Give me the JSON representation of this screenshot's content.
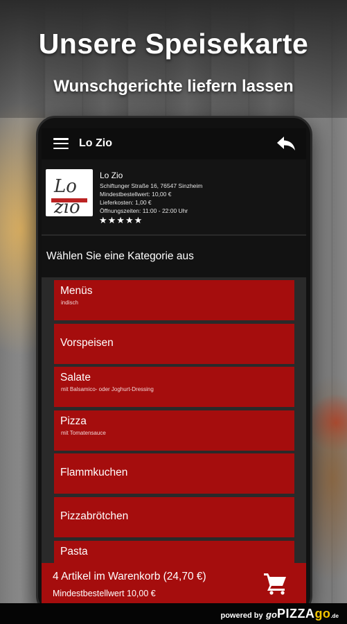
{
  "promo": {
    "headline": "Unsere Speisekarte",
    "subline": "Wunschgerichte liefern lassen"
  },
  "appbar": {
    "title": "Lo Zio",
    "menu_icon": "hamburger-menu-icon",
    "back_icon": "reply-back-arrow-icon"
  },
  "restaurant": {
    "name": "Lo Zio",
    "address": "Schiftunger Straße 16, 76547 Sinzheim",
    "min_order": "Mindestbestellwert: 10,00 €",
    "delivery_cost": "Lieferkosten: 1,00 €",
    "opening_hours": "Öffnungszeiten: 11:00 - 22:00 Uhr",
    "rating_stars": "★★★★★",
    "rating": 5,
    "logo_text": "Lo zio"
  },
  "category_prompt": "Wählen Sie eine Kategorie aus",
  "categories": [
    {
      "title": "Menüs",
      "subtitle": "indisch"
    },
    {
      "title": "Vorspeisen",
      "subtitle": ""
    },
    {
      "title": "Salate",
      "subtitle": "mit Balsamico- oder Joghurt-Dressing"
    },
    {
      "title": "Pizza",
      "subtitle": "mit Tomatensauce"
    },
    {
      "title": "Flammkuchen",
      "subtitle": ""
    },
    {
      "title": "Pizzabrötchen",
      "subtitle": ""
    },
    {
      "title": "Pasta",
      "subtitle": ""
    }
  ],
  "cart": {
    "title": "4 Artikel im Warenkorb (24,70 €)",
    "min_order": "Mindestbestellwert 10,00 €",
    "icon": "shopping-cart-icon"
  },
  "footer": {
    "powered_by": "powered by",
    "go_prefix": "go",
    "brand_pizza": "PIZZA",
    "brand_go": "go",
    "brand_tld": ".de"
  },
  "colors": {
    "accent_red": "#a50d0d",
    "app_bar": "#0d0d0d",
    "text": "#ffffff"
  }
}
